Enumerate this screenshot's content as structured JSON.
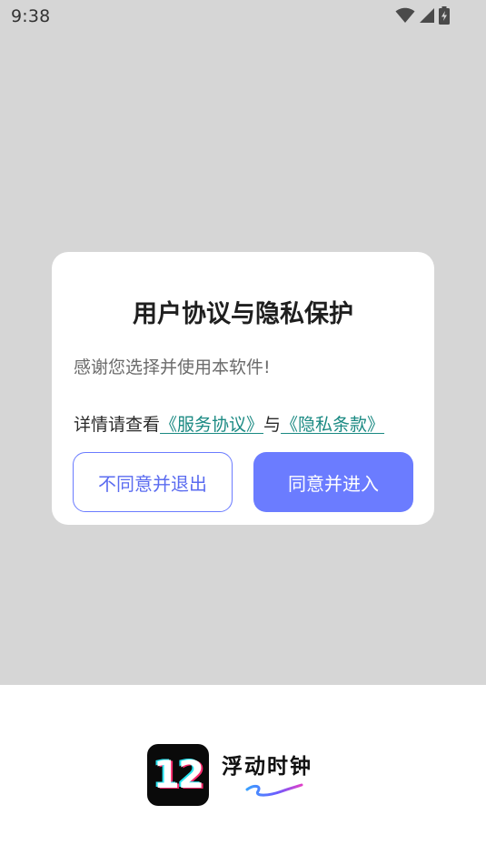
{
  "status_bar": {
    "time": "9:38",
    "icons": [
      "wifi-icon",
      "cell-signal-icon",
      "battery-charging-icon"
    ]
  },
  "dialog": {
    "title": "用户协议与隐私保护",
    "body": "感谢您选择并使用本软件!",
    "links_prefix": "详情请查看",
    "service_link": "《服务协议》",
    "links_joiner": "与",
    "privacy_link": "《隐私条款》",
    "reject_label": "不同意并退出",
    "accept_label": "同意并进入"
  },
  "brand": {
    "logo_text": "12",
    "app_name": "浮动时钟"
  },
  "colors": {
    "scrim": "#d6d6d6",
    "accent": "#6b7cff",
    "link": "#1b8a83"
  }
}
